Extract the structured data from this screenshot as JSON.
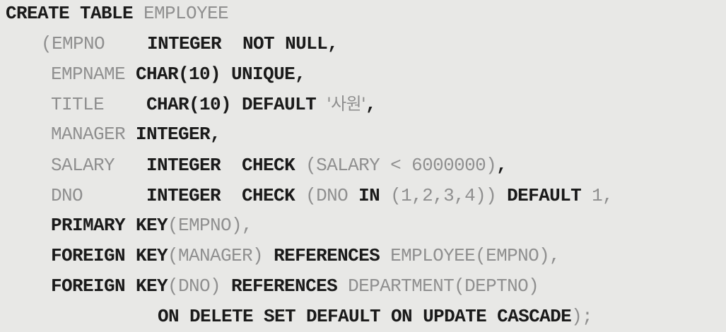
{
  "code": {
    "lines": [
      [
        {
          "t": "CREATE TABLE",
          "kw": true
        },
        {
          "t": " EMPLOYEE",
          "kw": false
        }
      ],
      [
        {
          "t": "(EMPNO    ",
          "kw": false
        },
        {
          "t": "INTEGER  NOT NULL,",
          "kw": true
        }
      ],
      [
        {
          "t": "EMPNAME ",
          "kw": false
        },
        {
          "t": "CHAR(10) UNIQUE,",
          "kw": true
        }
      ],
      [
        {
          "t": "TITLE    ",
          "kw": false
        },
        {
          "t": "CHAR(10) DEFAULT ",
          "kw": true
        },
        {
          "t": "'사원'",
          "kw": false,
          "str": true
        },
        {
          "t": ",",
          "kw": true
        }
      ],
      [
        {
          "t": "MANAGER ",
          "kw": false
        },
        {
          "t": "INTEGER,",
          "kw": true
        }
      ],
      [
        {
          "t": "SALARY   ",
          "kw": false
        },
        {
          "t": "INTEGER  CHECK ",
          "kw": true
        },
        {
          "t": "(SALARY < 6000000)",
          "kw": false
        },
        {
          "t": ",",
          "kw": true
        }
      ],
      [
        {
          "t": "DNO      ",
          "kw": false
        },
        {
          "t": "INTEGER  CHECK ",
          "kw": true
        },
        {
          "t": "(DNO ",
          "kw": false
        },
        {
          "t": "IN",
          "kw": true
        },
        {
          "t": " (1,2,3,4)) ",
          "kw": false
        },
        {
          "t": "DEFAULT",
          "kw": true
        },
        {
          "t": " 1,",
          "kw": false
        }
      ],
      [
        {
          "t": "PRIMARY KEY",
          "kw": true
        },
        {
          "t": "(EMPNO),",
          "kw": false
        }
      ],
      [
        {
          "t": "FOREIGN KEY",
          "kw": true
        },
        {
          "t": "(MANAGER) ",
          "kw": false
        },
        {
          "t": "REFERENCES",
          "kw": true
        },
        {
          "t": " EMPLOYEE(EMPNO),",
          "kw": false
        }
      ],
      [
        {
          "t": "FOREIGN KEY",
          "kw": true
        },
        {
          "t": "(DNO) ",
          "kw": false
        },
        {
          "t": "REFERENCES",
          "kw": true
        },
        {
          "t": " DEPARTMENT(DEPTNO)",
          "kw": false
        }
      ],
      [
        {
          "t": "ON DELETE SET DEFAULT ON UPDATE CASCADE",
          "kw": true
        },
        {
          "t": ");",
          "kw": false
        }
      ]
    ]
  }
}
